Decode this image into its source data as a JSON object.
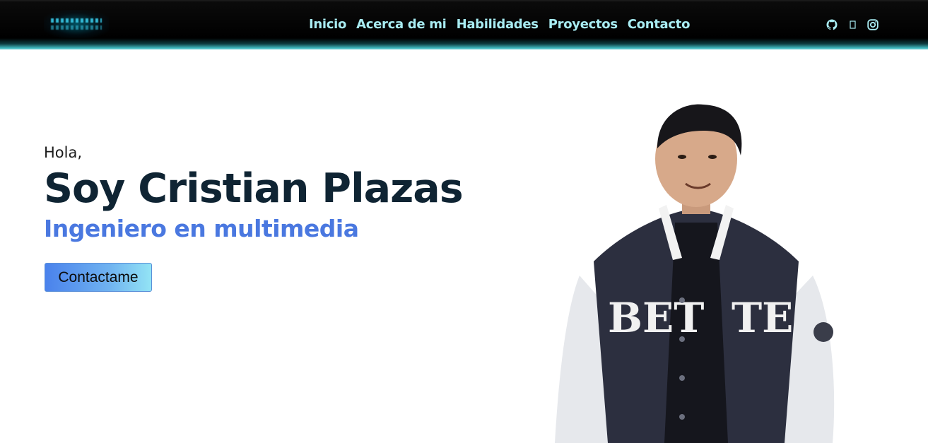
{
  "nav": {
    "links": [
      "Inicio",
      "Acerca de mi",
      "Habilidades",
      "Proyectos",
      "Contacto"
    ],
    "social_icons": [
      "github-icon",
      "linkedin-icon",
      "instagram-icon"
    ]
  },
  "hero": {
    "greeting": "Hola,",
    "name": "Soy Cristian Plazas",
    "role": "Ingeniero en multimedia",
    "cta_label": "Contactame"
  },
  "colors": {
    "nav_background": "#000000",
    "nav_link": "#a8ecf2",
    "name": "#0f2433",
    "role": "#4a78e0",
    "button_gradient_start": "#4a82ec",
    "button_gradient_end": "#93e4f5"
  }
}
